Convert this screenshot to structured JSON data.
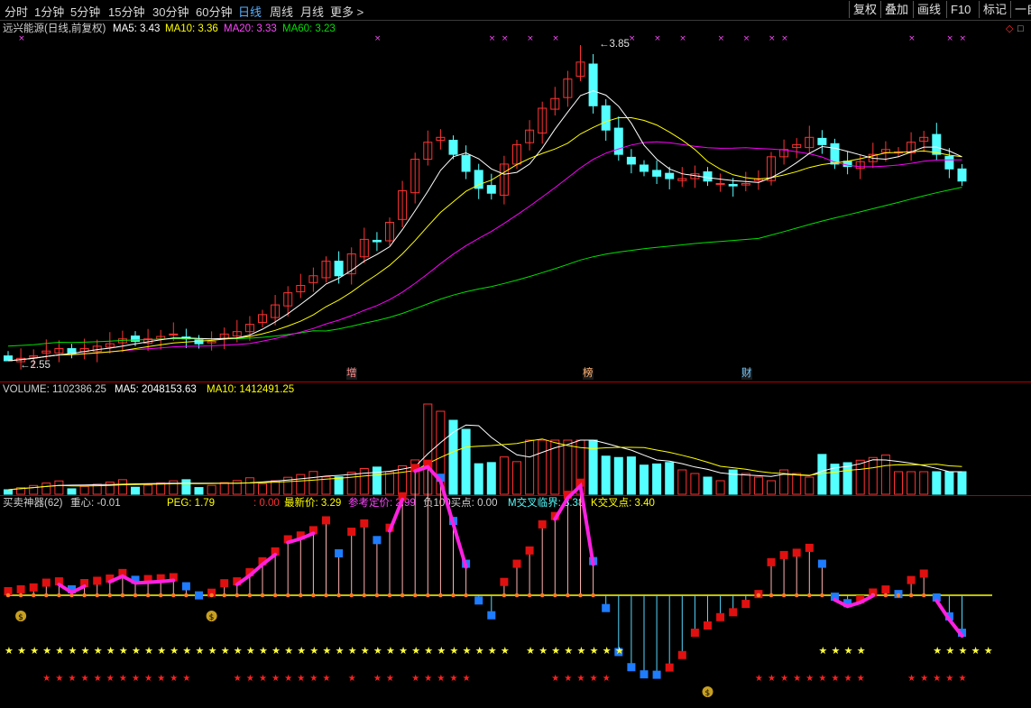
{
  "toolbar": {
    "periods": [
      "分时",
      "1分钟",
      "5分钟",
      "15分钟",
      "30分钟",
      "60分钟",
      "日线",
      "周线",
      "月线",
      "更多 >"
    ],
    "active": "日线",
    "right_buttons": [
      "复权",
      "叠加",
      "画线",
      "F10",
      "标记",
      "一自"
    ]
  },
  "main_chart": {
    "title": "远兴能源(日线,前复权)",
    "ma5": "MA5: 3.43",
    "ma10": "MA10: 3.36",
    "ma20": "MA20: 3.33",
    "ma60": "MA60: 3.23",
    "high_label": "3.85",
    "low_label": "2.55",
    "markers": [
      "增",
      "榜",
      "财"
    ]
  },
  "volume_chart": {
    "volume": "VOLUME: 1102386.25",
    "ma5": "MA5: 2048153.63",
    "ma10": "MA10: 1412491.25"
  },
  "indicator": {
    "name": "买卖神器(62)",
    "center": "重心: -0.01",
    "peg": "PEG: 1.79",
    "zero": ": 0.00",
    "latest": "最新价: 3.29",
    "ref": "参考定价: 2.99",
    "neg100": "负100买点: 0.00",
    "m_cross": "M交叉临界: 3.38",
    "k_cross": "K交叉点: 3.40",
    "money_icon": "money-bag-icon"
  },
  "colors": {
    "up": "#ff3232",
    "down": "#54ffff",
    "ma5": "#ffffff",
    "ma10": "#ffff00",
    "ma20": "#ff00ff",
    "ma60": "#00e000",
    "active_tab": "#5ab0ff"
  },
  "chart_data": {
    "type": "candlestick",
    "ma_values": {
      "MA5": 3.43,
      "MA10": 3.36,
      "MA20": 3.33,
      "MA60": 3.23
    },
    "price_high": 3.85,
    "price_low": 2.55,
    "close": [
      2.55,
      2.56,
      2.57,
      2.59,
      2.6,
      2.58,
      2.6,
      2.61,
      2.62,
      2.64,
      2.63,
      2.64,
      2.65,
      2.66,
      2.64,
      2.62,
      2.63,
      2.66,
      2.67,
      2.7,
      2.74,
      2.78,
      2.83,
      2.86,
      2.9,
      2.96,
      2.9,
      2.99,
      3.05,
      3.04,
      3.12,
      3.25,
      3.38,
      3.45,
      3.47,
      3.4,
      3.33,
      3.26,
      3.24,
      3.36,
      3.44,
      3.5,
      3.59,
      3.63,
      3.71,
      3.78,
      3.6,
      3.5,
      3.4,
      3.36,
      3.33,
      3.31,
      3.3,
      3.3,
      3.32,
      3.29,
      3.28,
      3.27,
      3.28,
      3.3,
      3.39,
      3.42,
      3.44,
      3.47,
      3.44,
      3.36,
      3.35,
      3.37,
      3.4,
      3.42,
      3.41,
      3.45,
      3.47,
      3.4,
      3.34,
      3.29
    ],
    "volume_mv": {
      "MA5": 2048153.63,
      "MA10": 1412491.25
    },
    "indicator_values": {
      "center": -0.01,
      "PEG": 1.79,
      "latest": 3.29,
      "ref_price": 2.99,
      "neg100_buy": 0.0,
      "m_cross": 3.38,
      "k_cross": 3.4
    }
  }
}
